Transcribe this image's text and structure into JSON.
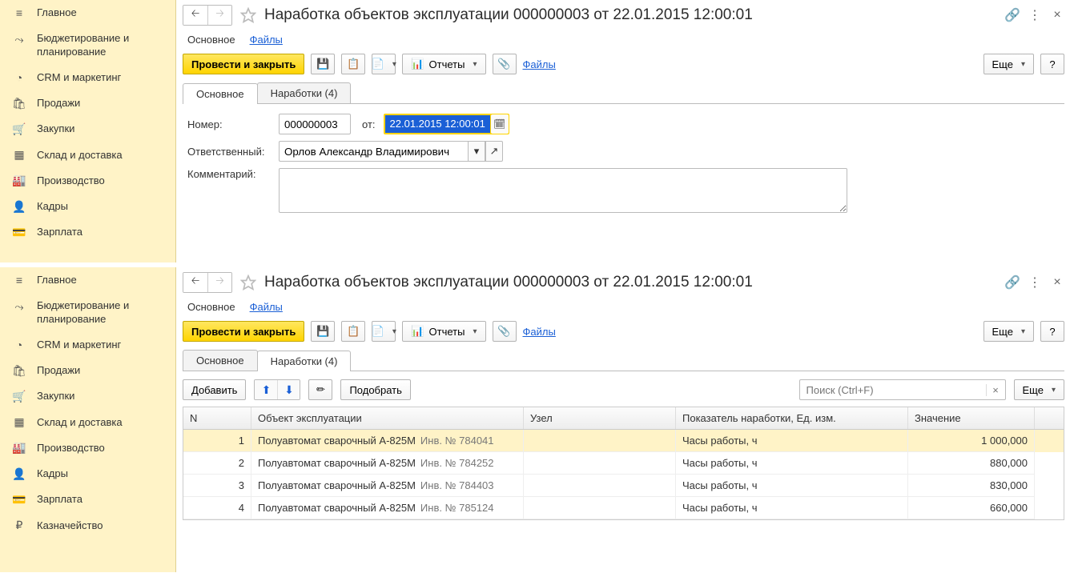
{
  "sidebar": {
    "items": [
      {
        "icon": "≡",
        "label": "Главное"
      },
      {
        "icon": "⤳",
        "label": "Бюджетирование и планирование",
        "ml": true
      },
      {
        "icon": "◔",
        "label": "CRM и маркетинг"
      },
      {
        "icon": "🛍",
        "label": "Продажи"
      },
      {
        "icon": "🛒",
        "label": "Закупки"
      },
      {
        "icon": "▦",
        "label": "Склад и доставка"
      },
      {
        "icon": "🏭",
        "label": "Производство"
      },
      {
        "icon": "👤",
        "label": "Кадры"
      },
      {
        "icon": "💳",
        "label": "Зарплата"
      }
    ],
    "items2": [
      {
        "icon": "≡",
        "label": "Главное"
      },
      {
        "icon": "⤳",
        "label": "Бюджетирование и планирование",
        "ml": true
      },
      {
        "icon": "◔",
        "label": "CRM и маркетинг"
      },
      {
        "icon": "🛍",
        "label": "Продажи"
      },
      {
        "icon": "🛒",
        "label": "Закупки"
      },
      {
        "icon": "▦",
        "label": "Склад и доставка"
      },
      {
        "icon": "🏭",
        "label": "Производство"
      },
      {
        "icon": "👤",
        "label": "Кадры"
      },
      {
        "icon": "💳",
        "label": "Зарплата"
      },
      {
        "icon": "₽",
        "label": "Казначейство"
      }
    ]
  },
  "title": "Наработка объектов эксплуатации 000000003 от 22.01.2015 12:00:01",
  "subnav": {
    "main": "Основное",
    "files": "Файлы"
  },
  "toolbar": {
    "post_close": "Провести и закрыть",
    "reports": "Отчеты",
    "files_link": "Файлы",
    "more": "Еще",
    "help": "?"
  },
  "tabs": {
    "main": "Основное",
    "works": "Наработки (4)"
  },
  "form": {
    "number_label": "Номер:",
    "number_value": "000000003",
    "from_label": "от:",
    "date_value": "22.01.2015 12:00:01",
    "resp_label": "Ответственный:",
    "resp_value": "Орлов Александр Владимирович",
    "comment_label": "Комментарий:"
  },
  "grid_toolbar": {
    "add": "Добавить",
    "pick": "Подобрать",
    "search_placeholder": "Поиск (Ctrl+F)",
    "more": "Еще"
  },
  "columns": {
    "n": "N",
    "obj": "Объект эксплуатации",
    "node": "Узел",
    "ind": "Показатель наработки, Ед. изм.",
    "val": "Значение"
  },
  "rows": [
    {
      "n": "1",
      "obj": "Полуавтомат сварочный А-825М",
      "inv": "Инв. № 784041",
      "node": "",
      "ind": "Часы работы, ч",
      "val": "1 000,000"
    },
    {
      "n": "2",
      "obj": "Полуавтомат сварочный А-825М",
      "inv": "Инв. № 784252",
      "node": "",
      "ind": "Часы работы, ч",
      "val": "880,000"
    },
    {
      "n": "3",
      "obj": "Полуавтомат сварочный А-825М",
      "inv": "Инв. № 784403",
      "node": "",
      "ind": "Часы работы, ч",
      "val": "830,000"
    },
    {
      "n": "4",
      "obj": "Полуавтомат сварочный А-825М",
      "inv": "Инв. № 785124",
      "node": "",
      "ind": "Часы работы, ч",
      "val": "660,000"
    }
  ]
}
